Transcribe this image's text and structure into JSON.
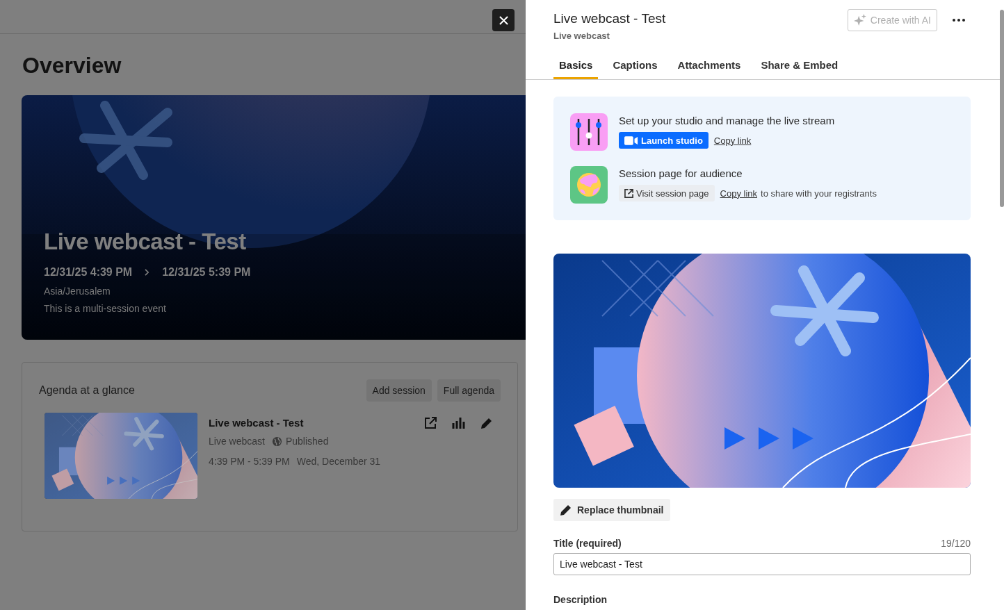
{
  "background_page": {
    "heading": "Overview",
    "hero": {
      "kind": "picture",
      "title": "Live webcast - Test",
      "start": "12/31/25 4:39 PM",
      "end": "12/31/25 5:39 PM",
      "timezone": "Asia/Jerusalem",
      "note": "This is a multi-session event"
    },
    "agenda": {
      "title": "Agenda at a glance",
      "buttons": [
        "Add session",
        "Full agenda"
      ],
      "sessions": [
        {
          "title": "Live webcast - Test",
          "type": "Live webcast",
          "status": "Published",
          "time": "4:39 PM - 5:39 PM",
          "date": "Wed, December 31"
        }
      ]
    }
  },
  "panel": {
    "title": "Live webcast - Test",
    "subtitle": "Live webcast",
    "ai_button": {
      "label": "Create with AI",
      "disabled": true
    },
    "tabs": [
      {
        "label": "Basics",
        "selected": true
      },
      {
        "label": "Captions",
        "selected": false
      },
      {
        "label": "Attachments",
        "selected": false
      },
      {
        "label": "Share & Embed",
        "selected": false
      }
    ],
    "actions": [
      {
        "kind": "studio",
        "heading": "Set up your studio and manage the live stream",
        "button": "Launch studio",
        "link": "Copy link"
      },
      {
        "kind": "session_page",
        "heading": "Session page for audience",
        "button": "Visit session page",
        "link": "Copy link",
        "suffix": "to share with your registrants"
      }
    ],
    "replace_button": "Replace thumbnail",
    "title_field": {
      "label": "Title (required)",
      "counter": "19/120",
      "value": "Live webcast - Test"
    },
    "description_label": "Description"
  }
}
